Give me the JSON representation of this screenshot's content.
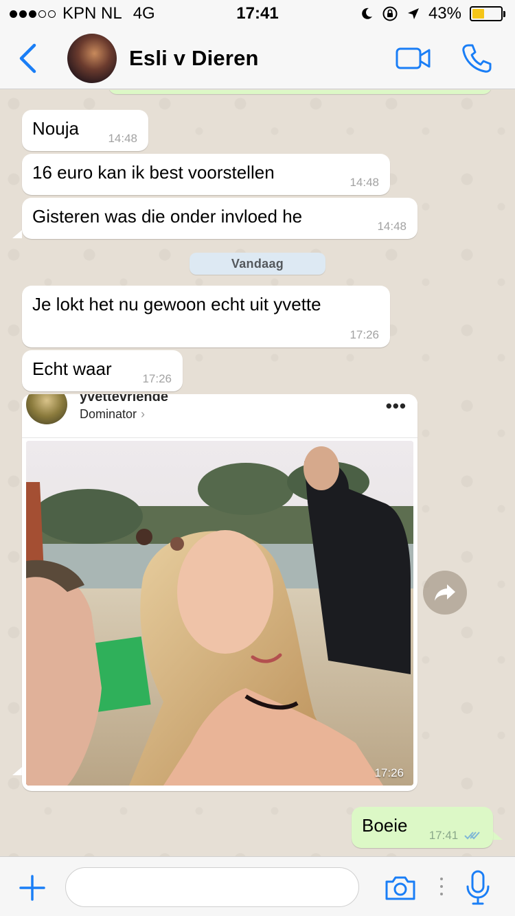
{
  "status_bar": {
    "carrier": "KPN NL",
    "network": "4G",
    "time": "17:41",
    "battery_percent": "43%",
    "battery_level": 0.43,
    "signal_bars_filled": 3,
    "signal_bars_total": 5
  },
  "header": {
    "contact_name": "Esli v Dieren",
    "accent_color": "#1a7ef6",
    "icons": [
      "chevron-left-icon",
      "video-camera-icon",
      "phone-icon"
    ]
  },
  "messages": [
    {
      "direction": "in",
      "text": "Nouja",
      "time": "14:48"
    },
    {
      "direction": "in",
      "text": "16 euro kan ik best voorstellen",
      "time": "14:48"
    },
    {
      "direction": "in",
      "text": "Gisteren was die onder invloed he",
      "time": "14:48"
    },
    {
      "direction": "in",
      "text": "Je lokt het nu gewoon echt uit yvette",
      "time": "17:26"
    },
    {
      "direction": "in",
      "text": "Echt waar",
      "time": "17:26"
    },
    {
      "direction": "out",
      "text": "Boeie",
      "time": "17:41",
      "status": "read"
    }
  ],
  "date_separator": "Vandaag",
  "image_message": {
    "username": "yvettevriende",
    "location": "Dominator",
    "location_chevron": "›",
    "more": "•••",
    "time": "17:26"
  },
  "input_bar": {
    "placeholder": "",
    "value": "",
    "icons": [
      "plus-icon",
      "camera-icon",
      "microphone-icon"
    ]
  },
  "colors": {
    "incoming_bubble": "#ffffff",
    "outgoing_bubble": "#dcf8c6",
    "chat_background": "#e6dfd5",
    "date_badge": "#dde9f3",
    "read_check": "#7fb6d6",
    "battery_fill": "#f5c518"
  }
}
